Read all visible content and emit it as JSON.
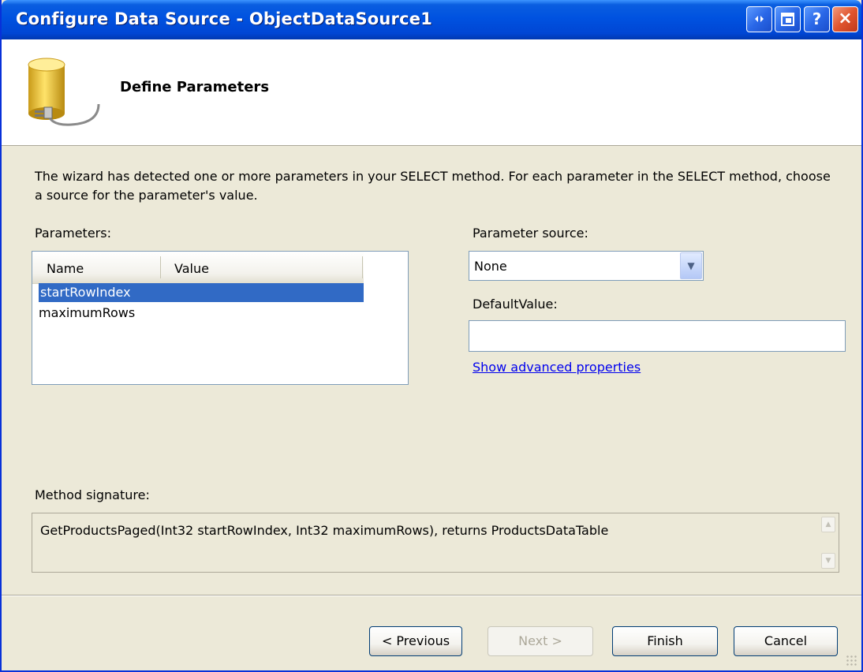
{
  "window": {
    "title": "Configure Data Source - ObjectDataSource1",
    "controls": {
      "help": "?",
      "close": "×"
    }
  },
  "header": {
    "title": "Define Parameters",
    "icon": "database-plug-icon"
  },
  "description": "The wizard has detected one or more parameters in your SELECT method. For each parameter in the SELECT method, choose a source for the parameter's value.",
  "parameters": {
    "label": "Parameters:",
    "columns": [
      "Name",
      "Value"
    ],
    "rows": [
      {
        "name": "startRowIndex",
        "selected": true
      },
      {
        "name": "maximumRows",
        "selected": false
      }
    ]
  },
  "parameter_source": {
    "label": "Parameter source:",
    "value": "None"
  },
  "default_value": {
    "label": "DefaultValue:",
    "value": ""
  },
  "advanced_link": "Show advanced properties",
  "method_signature": {
    "label": "Method signature:",
    "value": "GetProductsPaged(Int32 startRowIndex, Int32 maximumRows), returns ProductsDataTable"
  },
  "buttons": {
    "previous": "< Previous",
    "next": "Next >",
    "finish": "Finish",
    "cancel": "Cancel"
  },
  "colors": {
    "titlebar": "#0052e0",
    "selection": "#316ac5",
    "link": "#0000ee"
  }
}
